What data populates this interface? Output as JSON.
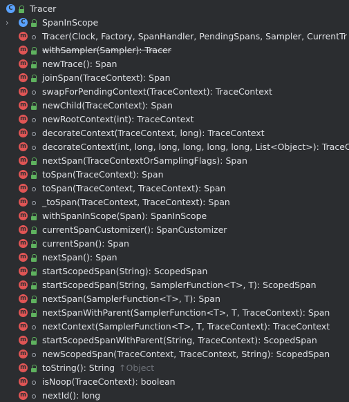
{
  "root": {
    "label": "Tracer",
    "kind": "C",
    "vis": "pub"
  },
  "nested": {
    "label": "SpanInScope",
    "kind": "C",
    "vis": "pub",
    "chevron": "›"
  },
  "members": [
    {
      "label": "Tracer(Clock, Factory, SpanHandler, PendingSpans, Sampler, CurrentTr",
      "vis": "pkg",
      "strike": false
    },
    {
      "label": "withSampler(Sampler): Tracer",
      "vis": "pub",
      "strike": true
    },
    {
      "label": "newTrace(): Span",
      "vis": "pub",
      "strike": false
    },
    {
      "label": "joinSpan(TraceContext): Span",
      "vis": "pub",
      "strike": false
    },
    {
      "label": "swapForPendingContext(TraceContext): TraceContext",
      "vis": "pkg",
      "strike": false
    },
    {
      "label": "newChild(TraceContext): Span",
      "vis": "pub",
      "strike": false
    },
    {
      "label": "newRootContext(int): TraceContext",
      "vis": "pkg",
      "strike": false
    },
    {
      "label": "decorateContext(TraceContext, long): TraceContext",
      "vis": "pkg",
      "strike": false
    },
    {
      "label": "decorateContext(int, long, long, long, long, long, List<Object>): TraceC",
      "vis": "pkg",
      "strike": false
    },
    {
      "label": "nextSpan(TraceContextOrSamplingFlags): Span",
      "vis": "pub",
      "strike": false
    },
    {
      "label": "toSpan(TraceContext): Span",
      "vis": "pub",
      "strike": false
    },
    {
      "label": "toSpan(TraceContext, TraceContext): Span",
      "vis": "pkg",
      "strike": false
    },
    {
      "label": "_toSpan(TraceContext, TraceContext): Span",
      "vis": "pkg",
      "strike": false
    },
    {
      "label": "withSpanInScope(Span): SpanInScope",
      "vis": "pub",
      "strike": false
    },
    {
      "label": "currentSpanCustomizer(): SpanCustomizer",
      "vis": "pub",
      "strike": false
    },
    {
      "label": "currentSpan(): Span",
      "vis": "pub",
      "strike": false
    },
    {
      "label": "nextSpan(): Span",
      "vis": "pub",
      "strike": false
    },
    {
      "label": "startScopedSpan(String): ScopedSpan",
      "vis": "pub",
      "strike": false
    },
    {
      "label": "startScopedSpan(String, SamplerFunction<T>, T): ScopedSpan",
      "vis": "pub",
      "strike": false
    },
    {
      "label": "nextSpan(SamplerFunction<T>, T): Span",
      "vis": "pub",
      "strike": false
    },
    {
      "label": "nextSpanWithParent(SamplerFunction<T>, T, TraceContext): Span",
      "vis": "pub",
      "strike": false
    },
    {
      "label": "nextContext(SamplerFunction<T>, T, TraceContext): TraceContext",
      "vis": "pkg",
      "strike": false
    },
    {
      "label": "startScopedSpanWithParent(String, TraceContext): ScopedSpan",
      "vis": "pub",
      "strike": false
    },
    {
      "label": "newScopedSpan(TraceContext, TraceContext, String): ScopedSpan",
      "vis": "pkg",
      "strike": false
    },
    {
      "label": "toString(): String",
      "vis": "pub",
      "strike": false,
      "inherited": "↑Object"
    },
    {
      "label": "isNoop(TraceContext): boolean",
      "vis": "pkg",
      "strike": false
    },
    {
      "label": "nextId(): long",
      "vis": "pkg",
      "strike": false
    }
  ],
  "icon_letters": {
    "method": "m",
    "class": "C"
  },
  "colors": {
    "background": "#2b2d30",
    "text": "#dfe1e5",
    "method": "#e05555",
    "class": "#5aa2ff",
    "public": "#5fb25f",
    "inherited": "#6f737a"
  }
}
